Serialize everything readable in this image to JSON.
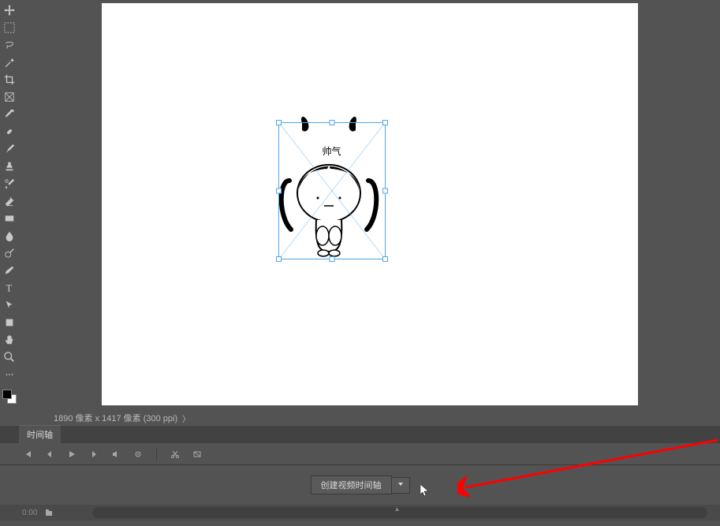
{
  "canvas": {
    "placed_text": "帅气"
  },
  "status": {
    "dimensions": "1890 像素 x 1417 像素 (300 ppi)"
  },
  "timeline": {
    "tab_label": "时间轴",
    "create_button": "创建视频时间轴",
    "footer_text": "0:00"
  }
}
